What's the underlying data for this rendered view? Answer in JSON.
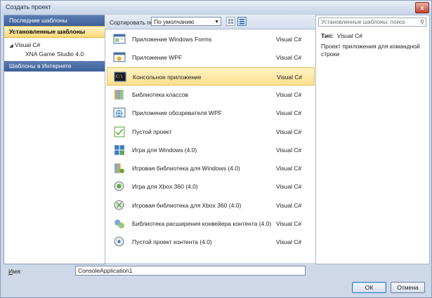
{
  "window": {
    "title": "Создать проект",
    "close_glyph": "x"
  },
  "sidebar": {
    "recent_label": "Последние шаблоны",
    "installed_label": "Установленные шаблоны",
    "tree": [
      {
        "label": "Visual C#",
        "expander": "◢"
      },
      {
        "label": "XNA Game Studio 4.0",
        "expander": ""
      }
    ],
    "online_label": "Шаблоны в Интернете"
  },
  "toolbar": {
    "sort_label": "Сортировать по:",
    "sort_value": "По умолчанию",
    "view_modes": [
      "medium-icons-view-icon",
      "list-view-icon"
    ],
    "selected_view": "list-view-icon"
  },
  "templates": [
    {
      "name": "Приложение Windows Forms",
      "lang": "Visual C#",
      "icon": "windows-forms-icon"
    },
    {
      "name": "Приложение WPF",
      "lang": "Visual C#",
      "icon": "wpf-app-icon"
    },
    {
      "name": "Консольное приложение",
      "lang": "Visual C#",
      "icon": "console-app-icon",
      "selected": true
    },
    {
      "name": "Библиотека классов",
      "lang": "Visual C#",
      "icon": "class-library-icon"
    },
    {
      "name": "Приложение обозревателя WPF",
      "lang": "Visual C#",
      "icon": "wpf-browser-icon"
    },
    {
      "name": "Пустой проект",
      "lang": "Visual C#",
      "icon": "empty-project-icon"
    },
    {
      "name": "Игра для Windows (4.0)",
      "lang": "Visual C#",
      "icon": "xna-game-icon"
    },
    {
      "name": "Игровая библиотека для Windows (4.0)",
      "lang": "Visual C#",
      "icon": "xna-library-icon"
    },
    {
      "name": "Игра для Xbox 360 (4.0)",
      "lang": "Visual C#",
      "icon": "xbox-game-icon"
    },
    {
      "name": "Игровая библиотека для Xbox 360 (4.0)",
      "lang": "Visual C#",
      "icon": "xbox-library-icon"
    },
    {
      "name": "Библиотека расширения конвейера контента (4.0)",
      "lang": "Visual C#",
      "icon": "pipeline-extension-icon"
    },
    {
      "name": "Пустой проект контента (4.0)",
      "lang": "Visual C#",
      "icon": "content-project-icon"
    }
  ],
  "details": {
    "search_placeholder": "Установленные шаблоны: поиск",
    "type_label": "Тип:",
    "type_value": "Visual C#",
    "description": "Проект приложения для командной строки"
  },
  "footer": {
    "name_label_underlined": "И",
    "name_label_rest": "мя:",
    "name_value": "ConsoleApplication1",
    "ok_label": "ОК",
    "cancel_label": "Отмена"
  },
  "colors": {
    "selection": "#fcdf8f",
    "sidebar_header": "#4a6ca6",
    "accent_green": "#5fa83a"
  }
}
